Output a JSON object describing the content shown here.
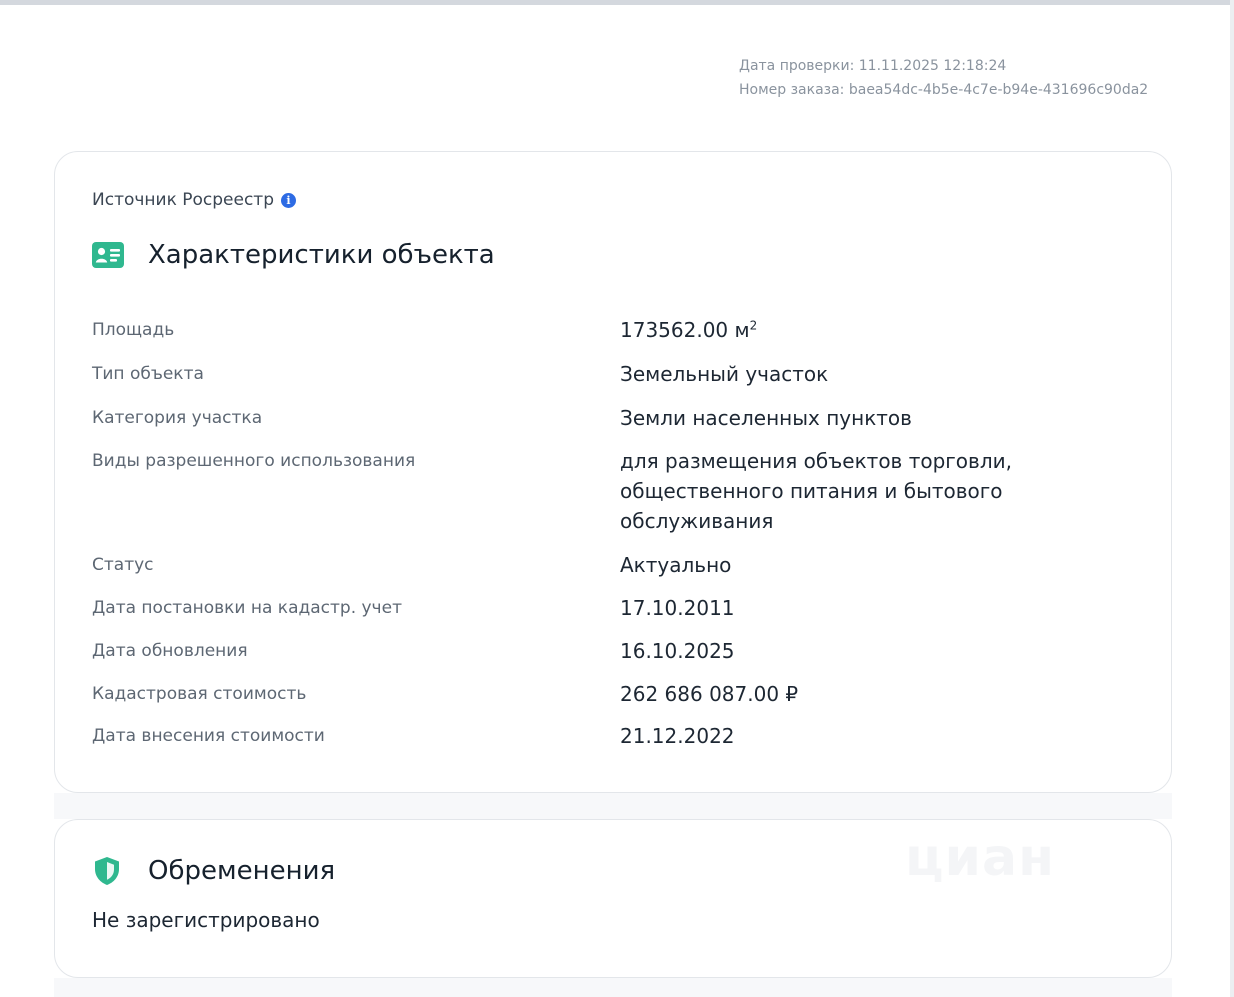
{
  "meta": {
    "check_date": "Дата проверки: 11.11.2025 12:18:24",
    "order_number": "Номер заказа: baea54dc-4b5e-4c7e-b94e-431696c90da2"
  },
  "characteristics": {
    "source_label": "Источник Росреестр",
    "title": "Характеристики объекта",
    "area": {
      "label": "Площадь",
      "value": "173562.00 м",
      "unit_sup": "2"
    },
    "object_type": {
      "label": "Тип объекта",
      "value": "Земельный участок"
    },
    "category": {
      "label": "Категория участка",
      "value": "Земли населенных пунктов"
    },
    "permitted_use": {
      "label": "Виды разрешенного использования",
      "value": "для размещения объектов торговли, общественного питания и бытового обслуживания"
    },
    "status": {
      "label": "Статус",
      "value": "Актуально"
    },
    "registration_date": {
      "label": "Дата постановки на кадастр. учет",
      "value": "17.10.2011"
    },
    "update_date": {
      "label": "Дата обновления",
      "value": "16.10.2025"
    },
    "cadastral_value": {
      "label": "Кадастровая стоимость",
      "value": "262 686 087.00 ₽"
    },
    "value_entry_date": {
      "label": "Дата внесения стоимости",
      "value": "21.12.2022"
    }
  },
  "encumbrances": {
    "title": "Обременения",
    "text": "Не зарегистрировано",
    "watermark": "циан"
  },
  "colors": {
    "accent_green": "#2fb88f",
    "info_blue": "#2d6be4",
    "label_gray": "#5d6773"
  },
  "icons": {
    "info": "info-icon",
    "id_card": "id-card-icon",
    "shield": "shield-icon"
  }
}
